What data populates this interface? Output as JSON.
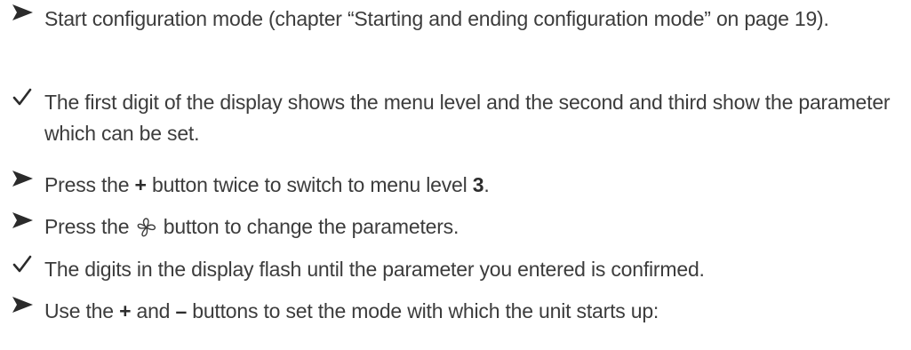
{
  "steps": [
    {
      "marker": "arrow-icon",
      "text": "Start configuration mode (chapter “Starting and ending configuration mode” on page 19)."
    },
    {
      "marker": "check-icon",
      "text": "The first digit of the display shows the menu level and the second and third show the parameter which can be set."
    },
    {
      "marker": "arrow-icon",
      "parts": [
        "Press the ",
        "+",
        " button twice to switch to menu level ",
        "3",
        "."
      ]
    },
    {
      "marker": "arrow-icon",
      "parts": [
        "Press the ",
        " button to change the parameters."
      ],
      "icon": "fan-icon"
    },
    {
      "marker": "check-icon",
      "text": "The digits in the display flash until the parameter you entered is confirmed."
    },
    {
      "marker": "arrow-icon",
      "parts": [
        "Use the ",
        "+",
        " and ",
        "–",
        " buttons to set the mode with which the unit starts up:"
      ]
    }
  ],
  "colors": {
    "text": "#3c3c3c",
    "marker": "#2b2b2b"
  }
}
